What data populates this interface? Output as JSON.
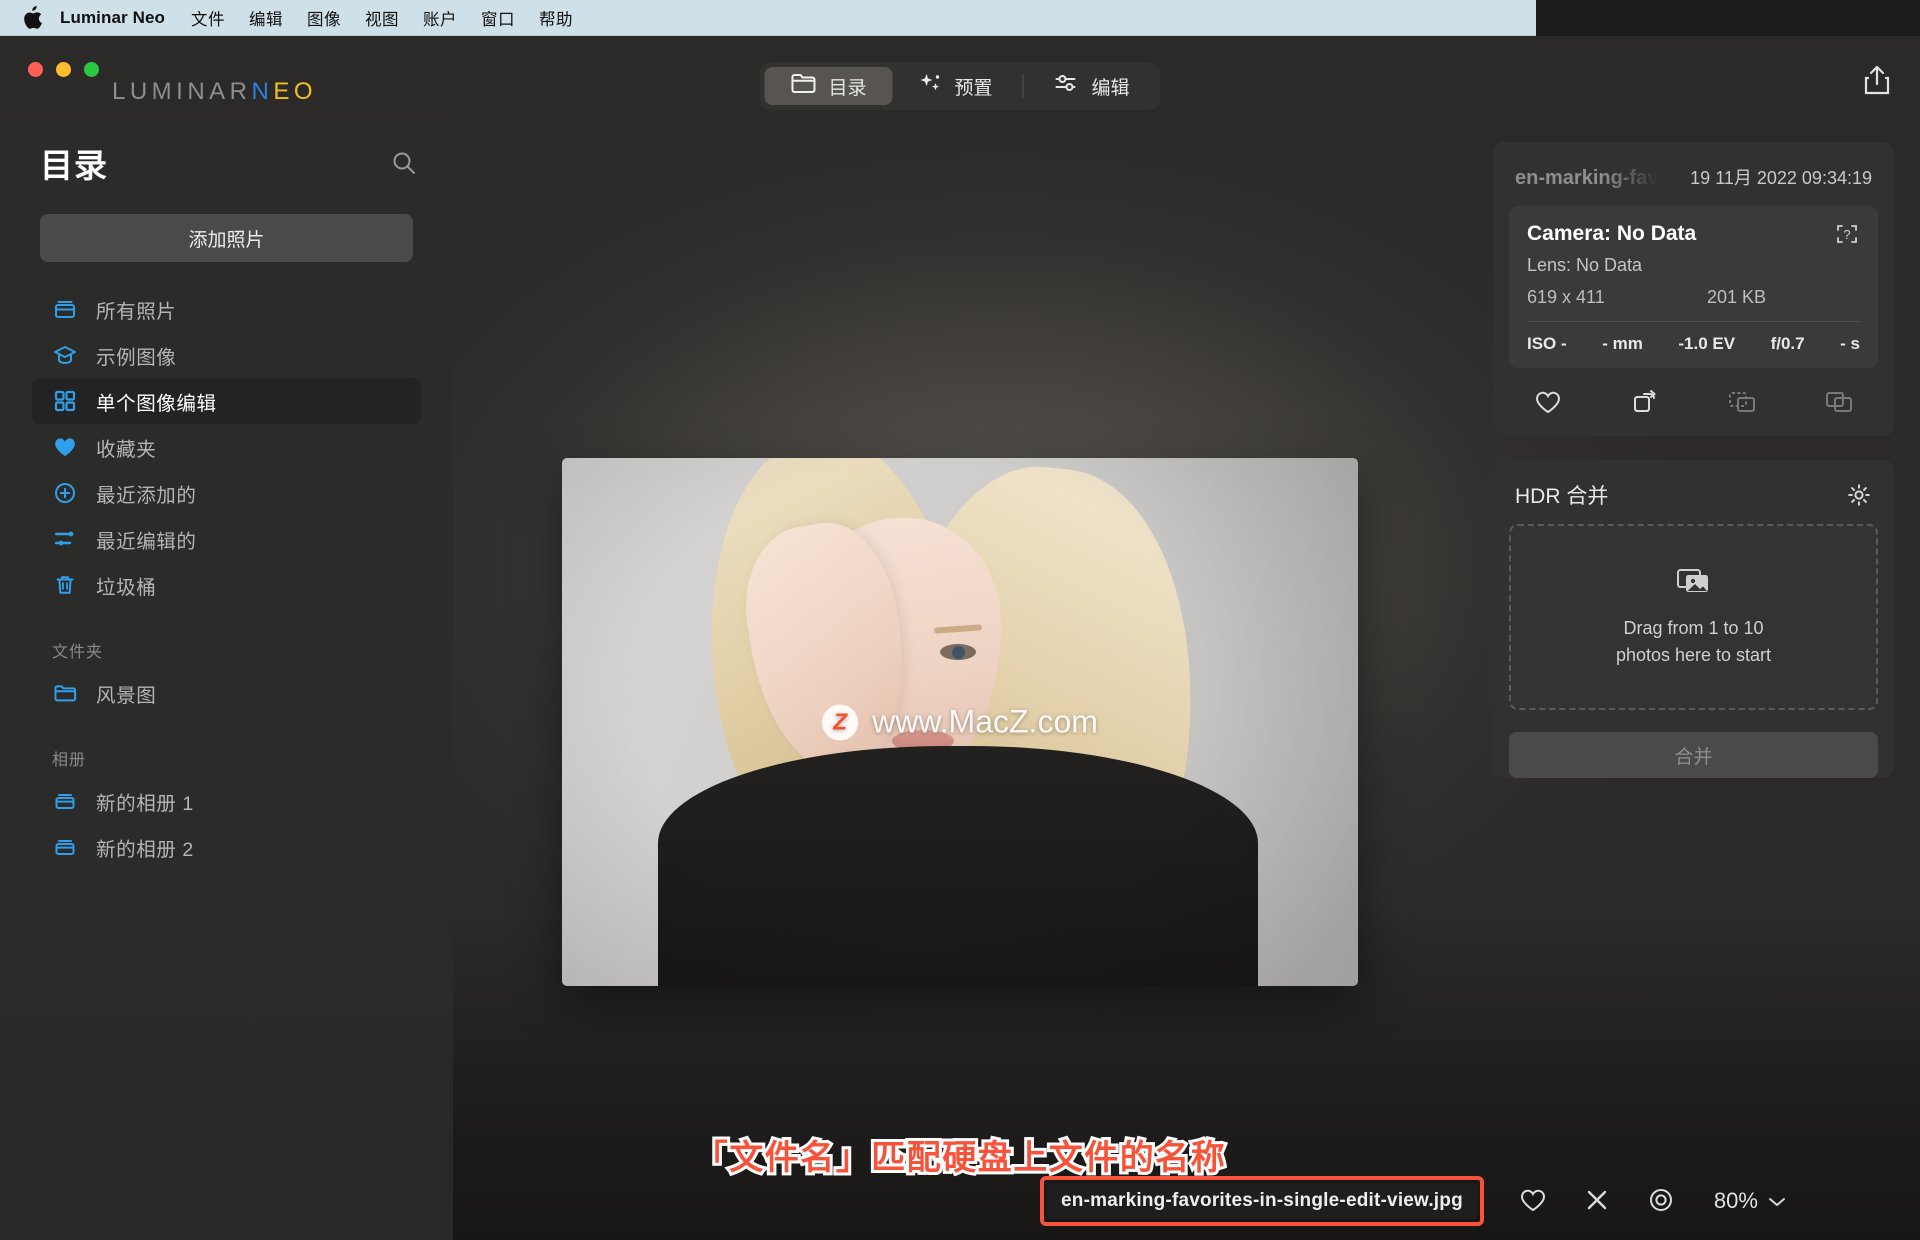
{
  "menubar": {
    "apple_icon": "apple-logo-icon",
    "app_name": "Luminar Neo",
    "items": [
      "文件",
      "编辑",
      "图像",
      "视图",
      "账户",
      "窗口",
      "帮助"
    ]
  },
  "window": {
    "logo": {
      "part1": "LUMINAR",
      "part2": "N",
      "part3": "EO"
    },
    "traffic_lights": [
      "close",
      "minimize",
      "zoom"
    ],
    "share_icon": "share-icon"
  },
  "tabs": [
    {
      "label": "目录",
      "icon": "folder-icon",
      "active": true
    },
    {
      "label": "预置",
      "icon": "sparkles-icon",
      "active": false
    },
    {
      "label": "编辑",
      "icon": "sliders-icon",
      "active": false
    }
  ],
  "sidebar": {
    "title": "目录",
    "search_icon": "search-icon",
    "add_photos_label": "添加照片",
    "items": [
      {
        "label": "所有照片",
        "icon": "library-icon",
        "active": false
      },
      {
        "label": "示例图像",
        "icon": "graduation-cap-icon",
        "active": false
      },
      {
        "label": "单个图像编辑",
        "icon": "grid-icon",
        "active": true
      },
      {
        "label": "收藏夹",
        "icon": "heart-filled-icon",
        "active": false
      },
      {
        "label": "最近添加的",
        "icon": "plus-circle-icon",
        "active": false
      },
      {
        "label": "最近编辑的",
        "icon": "sliders-icon",
        "active": false
      },
      {
        "label": "垃圾桶",
        "icon": "trash-icon",
        "active": false
      }
    ],
    "folders_section": "文件夹",
    "folders": [
      {
        "label": "风景图",
        "icon": "folder-icon"
      }
    ],
    "albums_section": "相册",
    "albums": [
      {
        "label": "新的相册 1",
        "icon": "album-icon"
      },
      {
        "label": "新的相册 2",
        "icon": "album-icon"
      }
    ]
  },
  "canvas": {
    "watermark": {
      "badge": "Z",
      "text": "www.MacZ.com"
    },
    "annotation": "「文件名」匹配硬盘上文件的名称"
  },
  "bottombar": {
    "filename": "en-marking-favorites-in-single-edit-view.jpg",
    "favorite_icon": "heart-outline-icon",
    "reject_icon": "close-x-icon",
    "preview_icon": "eye-icon",
    "zoom_level": "80%",
    "zoom_chevron": "chevron-down-icon"
  },
  "rightpanel": {
    "metadata": {
      "name": "en-marking-fav",
      "date": "19 11月 2022 09:34:19",
      "camera": "Camera: No Data",
      "help_icon": "question-mark-icon",
      "lens": "Lens: No Data",
      "dimensions": "619 x 411",
      "filesize": "201 KB",
      "shot": [
        "ISO -",
        "- mm",
        "-1.0 EV",
        "f/0.7",
        "- s"
      ]
    },
    "actions": [
      {
        "icon": "heart-outline-icon",
        "dim": false
      },
      {
        "icon": "rotate-icon",
        "dim": false
      },
      {
        "icon": "copy-dashed-icon",
        "dim": true
      },
      {
        "icon": "copy-icon",
        "dim": true
      }
    ],
    "hdr": {
      "title": "HDR 合并",
      "gear_icon": "gear-icon",
      "dropzone_icon": "photos-stack-icon",
      "dropzone_line1": "Drag from 1 to 10",
      "dropzone_line2": "photos here to start",
      "merge_label": "合并"
    }
  },
  "colors": {
    "accent_blue": "#2e9fe8",
    "annotation_red": "#f7523a",
    "logo_yellow": "#f0c020",
    "menubar_bg": "#cfe0e8"
  }
}
